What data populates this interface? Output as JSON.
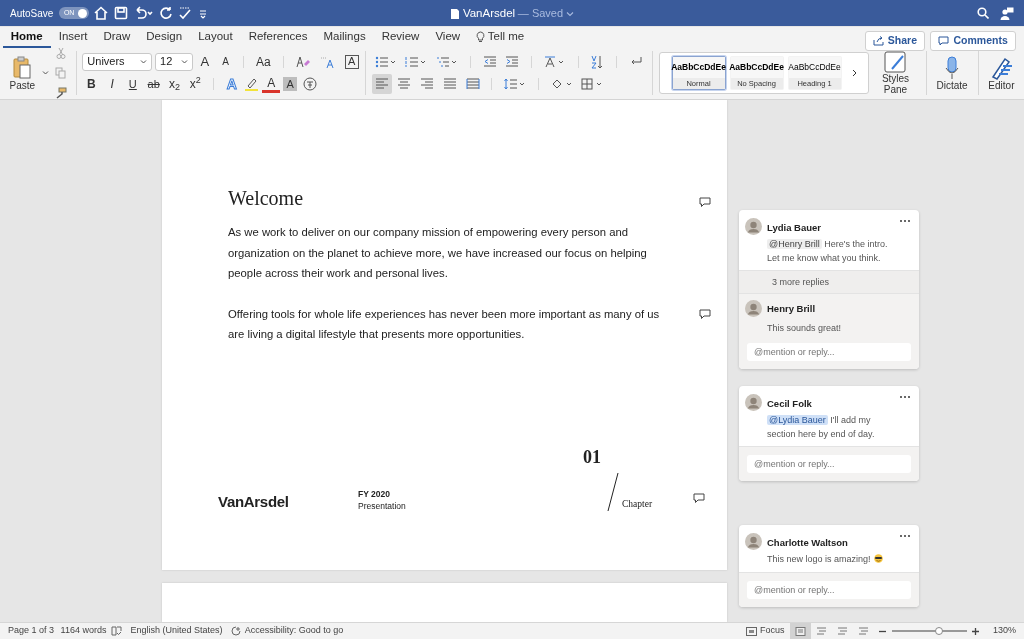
{
  "title_bar": {
    "autosave_label": "AutoSave",
    "autosave": {
      "on": true,
      "label": "ON"
    },
    "doc_title": "VanArsdel",
    "save_status": "— Saved"
  },
  "ribbon_tabs": [
    {
      "label": "Home",
      "selected": true
    },
    {
      "label": "Insert",
      "selected": false
    },
    {
      "label": "Draw",
      "selected": false
    },
    {
      "label": "Design",
      "selected": false
    },
    {
      "label": "Layout",
      "selected": false
    },
    {
      "label": "References",
      "selected": false
    },
    {
      "label": "Mailings",
      "selected": false
    },
    {
      "label": "Review",
      "selected": false
    },
    {
      "label": "View",
      "selected": false
    }
  ],
  "tell_me": "Tell me",
  "actions": {
    "share": "Share",
    "comments": "Comments"
  },
  "clipboard": {
    "paste": "Paste"
  },
  "font": {
    "name": "Univers",
    "size": "12",
    "grow": "A",
    "shrink": "A",
    "change_case": "Aa",
    "border_char": "A",
    "format_buttons": [
      {
        "label": "B"
      },
      {
        "label": "I"
      },
      {
        "label": "U"
      },
      {
        "label": "ab"
      },
      {
        "label": "x$_{2}$"
      },
      {
        "label": "x$^{2}$"
      }
    ],
    "color_buttons": [
      {
        "label": "A",
        "kind": "effects"
      },
      {
        "label": "A",
        "kind": "color"
      },
      {
        "label": "A",
        "kind": "shading"
      }
    ]
  },
  "paragraph": {
    "alignment": [
      {
        "selected": true
      },
      {
        "selected": false
      },
      {
        "selected": false
      },
      {
        "selected": false
      },
      {
        "selected": false
      }
    ]
  },
  "styles": [
    {
      "sample": "AaBbCcDdEe",
      "name": "Normal",
      "selected": true
    },
    {
      "sample": "AaBbCcDdEe",
      "name": "No Spacing",
      "selected": false
    },
    {
      "sample": "AaBbCcDdEe",
      "name": "Heading 1",
      "selected": false
    }
  ],
  "styles_pane": "Styles Pane",
  "dictate": "Dictate",
  "editor": "Editor",
  "document": {
    "heading": "Welcome",
    "paragraphs": [
      "As we work to deliver on our company mission of empowering every person and organization on the planet to achieve more, we have increased our focus on helping people across their work and personal lives.",
      "Offering tools for whole life experiences has never been more important as many of us are living a digital lifestyle that presents more opportunities."
    ],
    "footer": {
      "logo": "VanArsdel",
      "year": "FY 2020",
      "subtitle": "Presentation",
      "chapter_number": "01",
      "chapter_label": "Chapter"
    }
  },
  "comments": [
    {
      "author": "Lydia Bauer",
      "mention": "@Henry Brill",
      "mention_highlighted": false,
      "text": "Here's the intro. Let me know what you think.",
      "emoji": false,
      "more_replies": "3 more replies",
      "replies": [
        {
          "author": "Henry Brill",
          "text": "This sounds great!"
        }
      ],
      "reply_placeholder": "@mention or reply..."
    },
    {
      "author": "Cecil Folk",
      "mention": "@Lydia Bauer",
      "mention_highlighted": true,
      "text": "I'll add my section here by end of day.",
      "emoji": false,
      "reply_placeholder": "@mention or reply..."
    },
    {
      "author": "Charlotte Waltson",
      "text": "This new logo is amazing!",
      "emoji": true,
      "reply_placeholder": "@mention or reply..."
    }
  ],
  "status_bar": {
    "page": "Page 1 of 3",
    "words": "1164 words",
    "language": "English (United States)",
    "accessibility": "Accessibility: Good to go",
    "focus": "Focus",
    "views": [
      {
        "selected": true
      },
      {
        "selected": false
      },
      {
        "selected": false
      },
      {
        "selected": false
      }
    ],
    "zoom": {
      "level": 0.63,
      "label": "130%"
    }
  }
}
